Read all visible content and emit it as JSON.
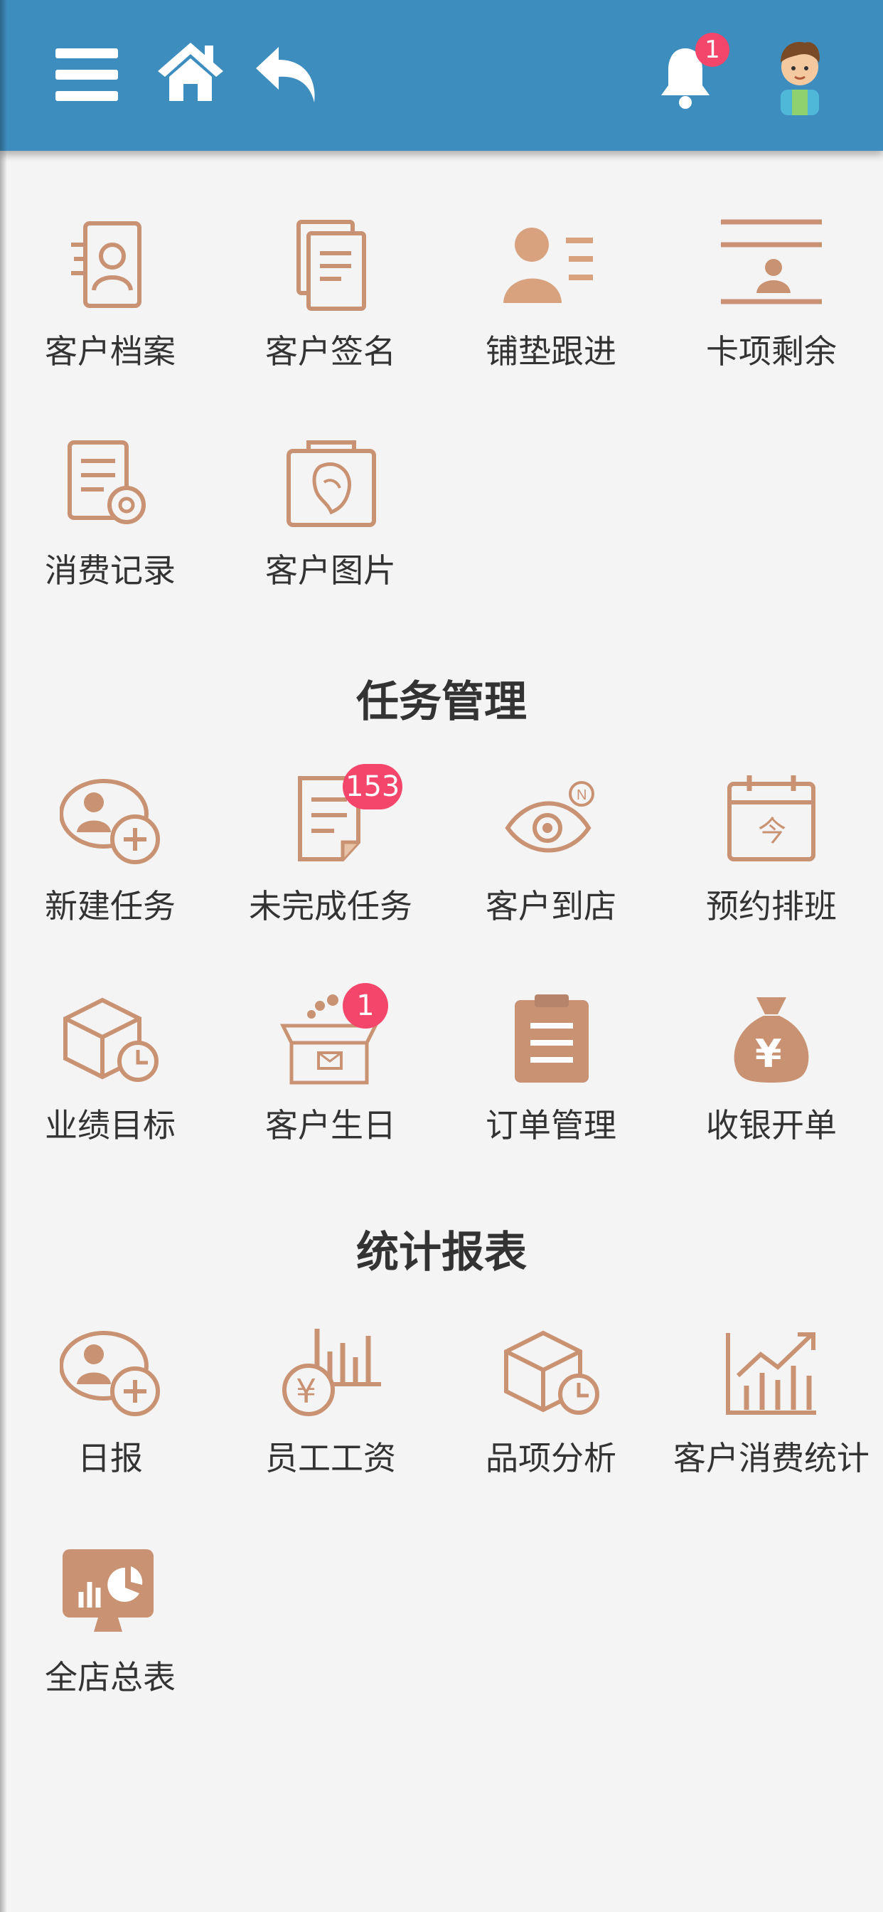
{
  "header": {
    "notification_count": "1",
    "accent_color": "#3e8dbf",
    "badge_color": "#f4466b",
    "icons": [
      "menu-icon",
      "home-icon",
      "back-arrow-icon",
      "bell-icon",
      "user-avatar"
    ]
  },
  "sections": {
    "customer": {
      "items": [
        {
          "label": "客户档案",
          "icon": "profile-card-icon"
        },
        {
          "label": "客户签名",
          "icon": "document-stack-icon"
        },
        {
          "label": "铺垫跟进",
          "icon": "person-list-icon"
        },
        {
          "label": "卡项剩余",
          "icon": "id-card-icon"
        },
        {
          "label": "消费记录",
          "icon": "document-gear-icon"
        },
        {
          "label": "客户图片",
          "icon": "photo-portrait-icon"
        }
      ]
    },
    "tasks": {
      "title": "任务管理",
      "items": [
        {
          "label": "新建任务",
          "icon": "add-person-icon"
        },
        {
          "label": "未完成任务",
          "icon": "note-icon",
          "badge": "153"
        },
        {
          "label": "客户到店",
          "icon": "eye-refresh-icon"
        },
        {
          "label": "预约排班",
          "icon": "calendar-today-icon"
        },
        {
          "label": "业绩目标",
          "icon": "box-clock-icon"
        },
        {
          "label": "客户生日",
          "icon": "gift-box-icon",
          "badge": "1"
        },
        {
          "label": "订单管理",
          "icon": "clipboard-icon"
        },
        {
          "label": "收银开单",
          "icon": "money-bag-icon"
        }
      ]
    },
    "reports": {
      "title": "统计报表",
      "items": [
        {
          "label": "日报",
          "icon": "add-person-icon"
        },
        {
          "label": "员工工资",
          "icon": "yen-chart-icon"
        },
        {
          "label": "品项分析",
          "icon": "box-clock-icon"
        },
        {
          "label": "客户消费统计",
          "icon": "trend-chart-icon"
        },
        {
          "label": "全店总表",
          "icon": "monitor-chart-icon"
        }
      ]
    }
  },
  "icon_colors": {
    "light": "#e7b48f",
    "dark": "#b5846a"
  }
}
